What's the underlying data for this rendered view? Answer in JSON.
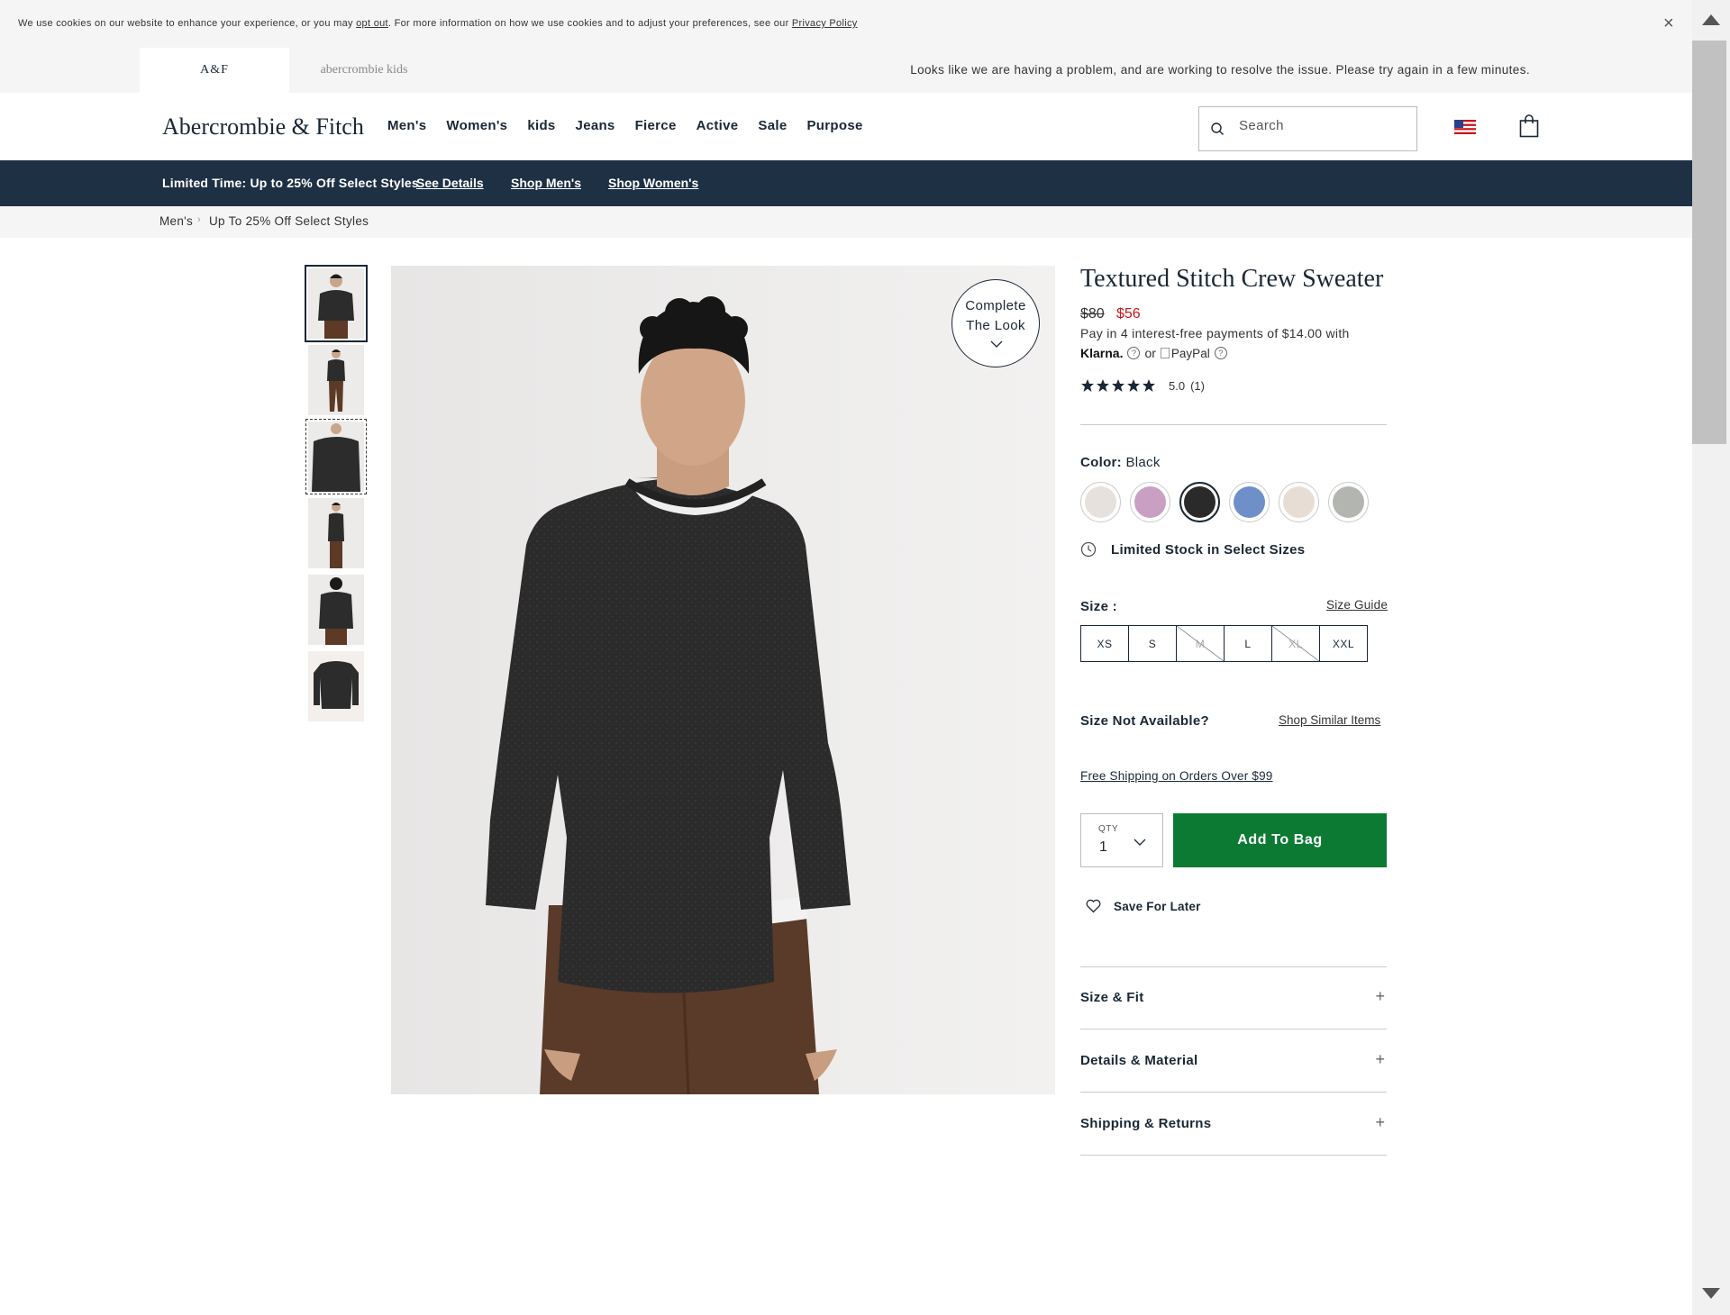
{
  "cookie": {
    "text_before": "We use cookies on our website to enhance your experience, or you may ",
    "opt_out": "opt out",
    "text_middle": ". For more information on how we use cookies and to adjust your preferences, see our ",
    "privacy_policy": "Privacy Policy",
    "close": "×"
  },
  "brand_strip": {
    "tabs": [
      {
        "label": "A&F"
      },
      {
        "label": "abercrombie kids"
      }
    ],
    "message": "Looks like we are having a problem, and are working to resolve the issue. Please try again in a few minutes."
  },
  "header": {
    "logo": "Abercrombie & Fitch",
    "nav": [
      "Men's",
      "Women's",
      "kids",
      "Jeans",
      "Fierce",
      "Active",
      "Sale",
      "Purpose"
    ],
    "search_placeholder": "Search"
  },
  "promo": {
    "text": "Limited Time: Up to 25% Off Select Styles",
    "links": [
      "See Details",
      "Shop Men's",
      "Shop Women's"
    ]
  },
  "breadcrumb": [
    "Men's",
    "Up To 25% Off Select Styles"
  ],
  "complete_look": {
    "line1": "Complete",
    "line2": "The Look"
  },
  "product": {
    "title": "Textured Stitch Crew Sweater",
    "price_old": "$80",
    "price_new": "$56",
    "installments": "Pay in 4 interest-free payments of $14.00 with",
    "klarna": "Klarna.",
    "or": "or",
    "paypal_alt": "PayPal",
    "help_glyph": "?",
    "rating_score": "5.0",
    "rating_count": "(1)",
    "rating_stars": 5,
    "color_label": "Color:",
    "color_value": "Black",
    "swatches": [
      {
        "name": "oatmeal",
        "color": "#e6e1dc"
      },
      {
        "name": "lilac",
        "color": "#c9a0c4"
      },
      {
        "name": "black",
        "color": "#2a2a2a"
      },
      {
        "name": "blue",
        "color": "#6f8fc9"
      },
      {
        "name": "cream-stripe",
        "color": "#e8ddd4"
      },
      {
        "name": "grey",
        "color": "#b3b6b0"
      }
    ],
    "stock_message": "Limited Stock in Select Sizes",
    "size_label": "Size :",
    "size_guide": "Size Guide",
    "sizes": [
      {
        "label": "XS",
        "available": true
      },
      {
        "label": "S",
        "available": true
      },
      {
        "label": "M",
        "available": false
      },
      {
        "label": "L",
        "available": true
      },
      {
        "label": "XL",
        "available": false
      },
      {
        "label": "XXL",
        "available": true
      }
    ],
    "size_not_available": "Size Not Available?",
    "shop_similar": "Shop Similar Items",
    "free_shipping": "Free Shipping on Orders Over $99",
    "qty_label": "QTY",
    "qty_value": "1",
    "add_to_bag": "Add To Bag",
    "save_for_later": "Save For Later",
    "accordions": [
      "Size & Fit",
      "Details & Material",
      "Shipping & Returns"
    ],
    "accordion_glyph": "+"
  },
  "colors": {
    "navy": "#1e3044",
    "sale_red": "#c7161d",
    "add_green": "#0d7a34"
  }
}
